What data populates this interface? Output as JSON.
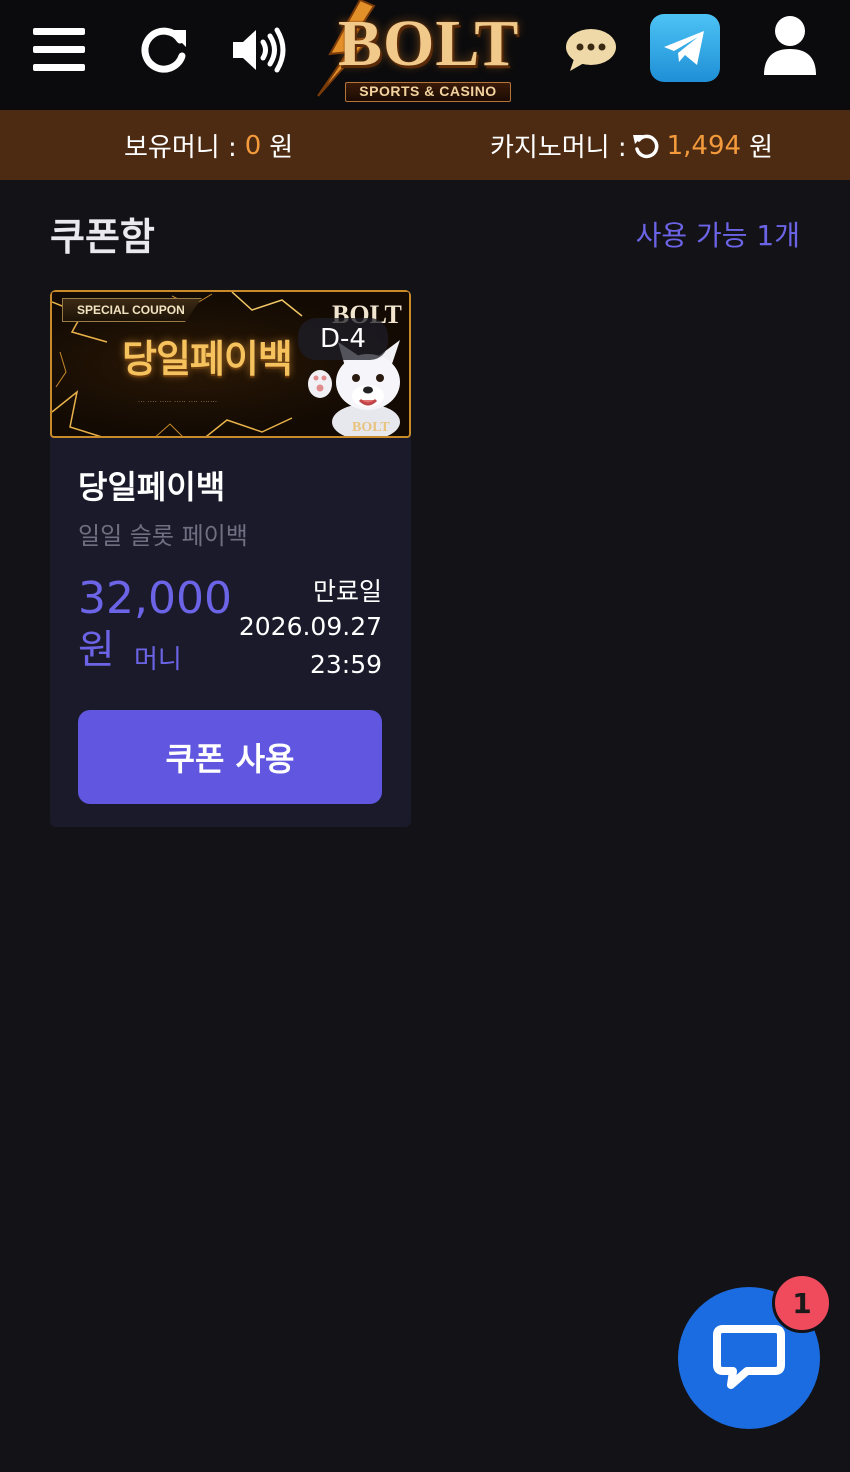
{
  "header": {
    "logo_text": "BOLT",
    "logo_subtitle": "SPORTS & CASINO",
    "icons": [
      "menu-icon",
      "refresh-icon",
      "volume-icon",
      "chat-bubble-icon",
      "telegram-icon",
      "user-icon"
    ]
  },
  "money": {
    "held_label": "보유머니 :",
    "held_value": "0",
    "held_unit": "원",
    "casino_label": "카지노머니 :",
    "casino_value": "1,494",
    "casino_unit": "원"
  },
  "coupon_box": {
    "title": "쿠폰함",
    "available": "사용 가능 1개"
  },
  "coupon": {
    "banner_tag": "SPECIAL COUPON",
    "banner_title": "당일페이백",
    "banner_logo": "BOLT",
    "banner_logo_small": "BOLT",
    "d_day": "D-4",
    "name": "당일페이백",
    "description": "일일 슬롯 페이백",
    "amount": "32,000",
    "amount_unit": "원",
    "money_label": "머니",
    "expiry_label": "만료일",
    "expiry_date": "2026.09.27",
    "expiry_time": "23:59",
    "use_button": "쿠폰 사용"
  },
  "chat_fab": {
    "badge_count": "1"
  },
  "colors": {
    "background": "#131217",
    "topbar": "#0b0b0d",
    "moneybar": "#4d2b12",
    "accent": "#6056df",
    "orange": "#f39a3c",
    "fab": "#1b6ce0",
    "badge": "#f04b5d"
  }
}
